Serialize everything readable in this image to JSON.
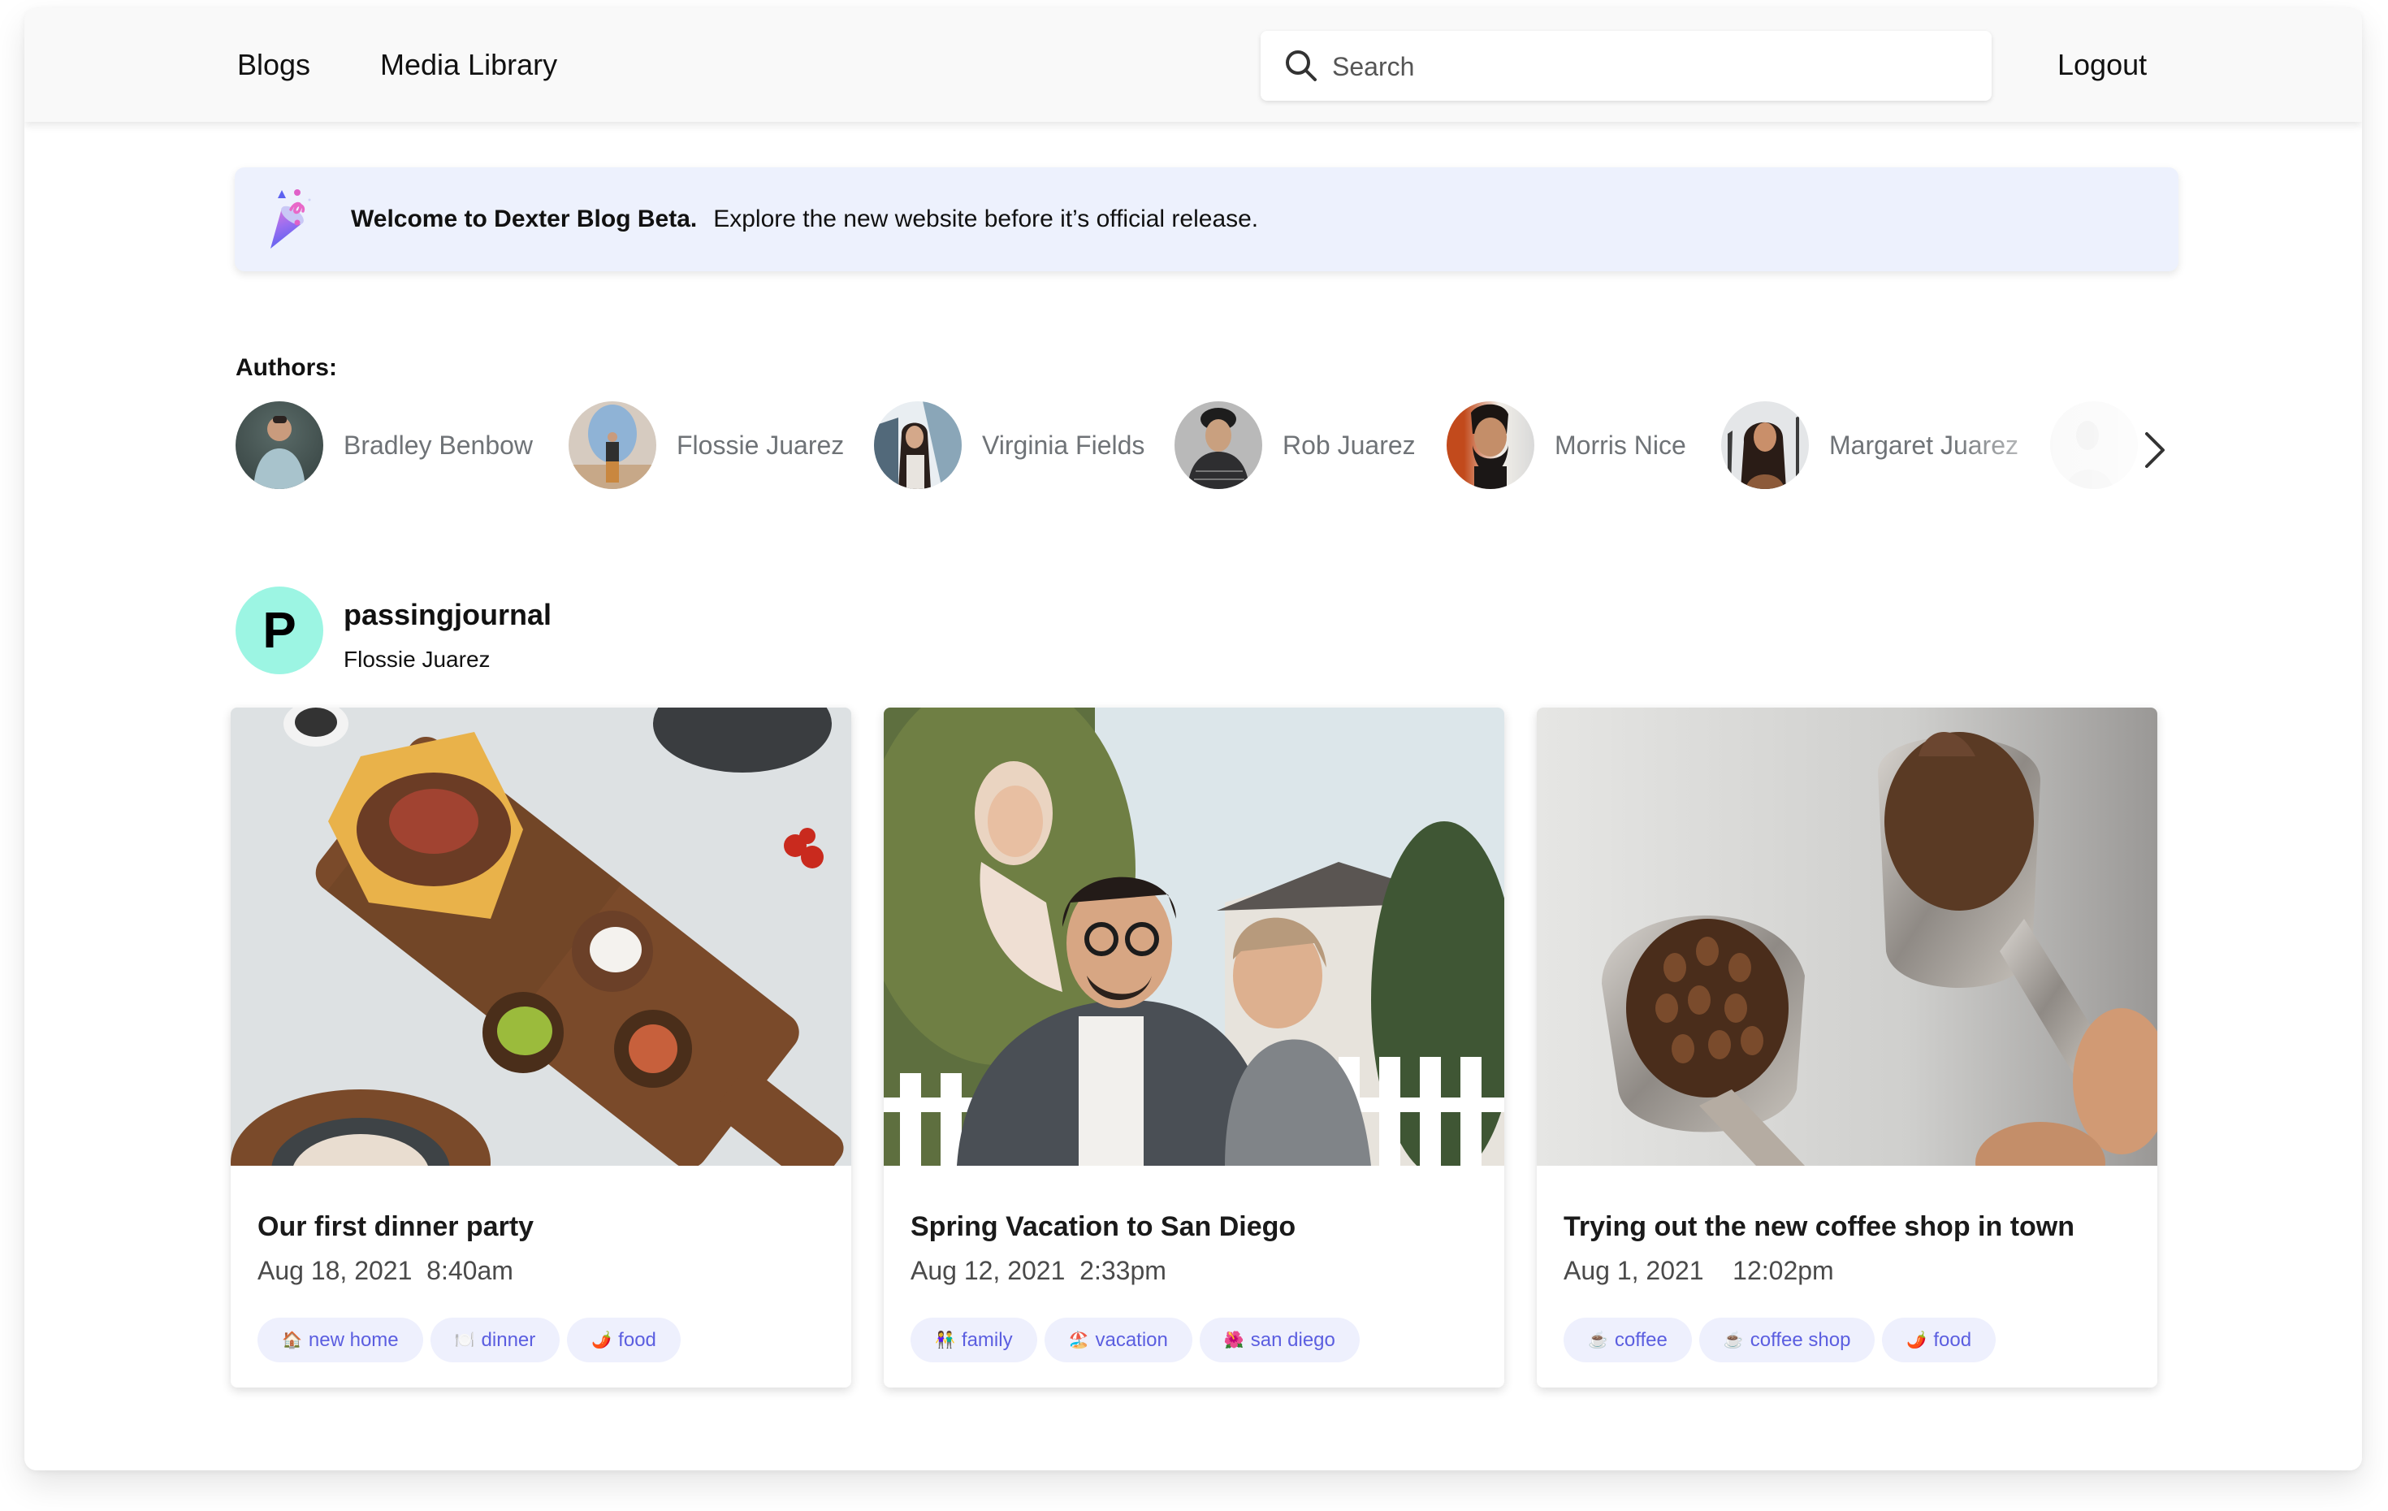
{
  "header": {
    "nav": [
      {
        "label": "Blogs"
      },
      {
        "label": "Media Library"
      }
    ],
    "search": {
      "placeholder": "Search",
      "value": ""
    },
    "logout_label": "Logout"
  },
  "banner": {
    "icon": "party-popper-icon",
    "title": "Welcome to Dexter Blog Beta.",
    "message": "Explore the new website before it’s official release."
  },
  "authors": {
    "label": "Authors:",
    "items": [
      {
        "name": "Bradley Benbow"
      },
      {
        "name": "Flossie Juarez"
      },
      {
        "name": "Virginia Fields"
      },
      {
        "name": "Rob Juarez"
      },
      {
        "name": "Morris Nice"
      },
      {
        "name": "Margaret Juarez"
      },
      {
        "name": ""
      }
    ],
    "next_icon": "chevron-right-icon"
  },
  "blog": {
    "avatar_letter": "P",
    "avatar_color": "#9cf5e3",
    "name": "passingjournal",
    "author": "Flossie Juarez",
    "posts": [
      {
        "title": "Our first dinner party",
        "date": "Aug 18, 2021",
        "time": "8:40am",
        "tags": [
          {
            "emoji": "🏠",
            "label": "new home"
          },
          {
            "emoji": "🍽️",
            "label": "dinner"
          },
          {
            "emoji": "🌶️",
            "label": "food"
          }
        ]
      },
      {
        "title": "Spring Vacation to San Diego",
        "date": "Aug 12, 2021",
        "time": "2:33pm",
        "tags": [
          {
            "emoji": "👫",
            "label": "family"
          },
          {
            "emoji": "🏖️",
            "label": "vacation"
          },
          {
            "emoji": "🌺",
            "label": "san diego"
          }
        ]
      },
      {
        "title": "Trying out the new coffee shop in town",
        "date": "Aug 1, 2021",
        "time": "12:02pm",
        "tags": [
          {
            "emoji": "☕",
            "label": "coffee"
          },
          {
            "emoji": "☕",
            "label": "coffee shop"
          },
          {
            "emoji": "🌶️",
            "label": "food"
          }
        ]
      }
    ]
  },
  "colors": {
    "header_bg": "#f9f9f9",
    "banner_bg": "#edf1fd",
    "tag_bg": "#eef0fd",
    "tag_text": "#5b5ee0",
    "author_name": "#6f7377"
  }
}
